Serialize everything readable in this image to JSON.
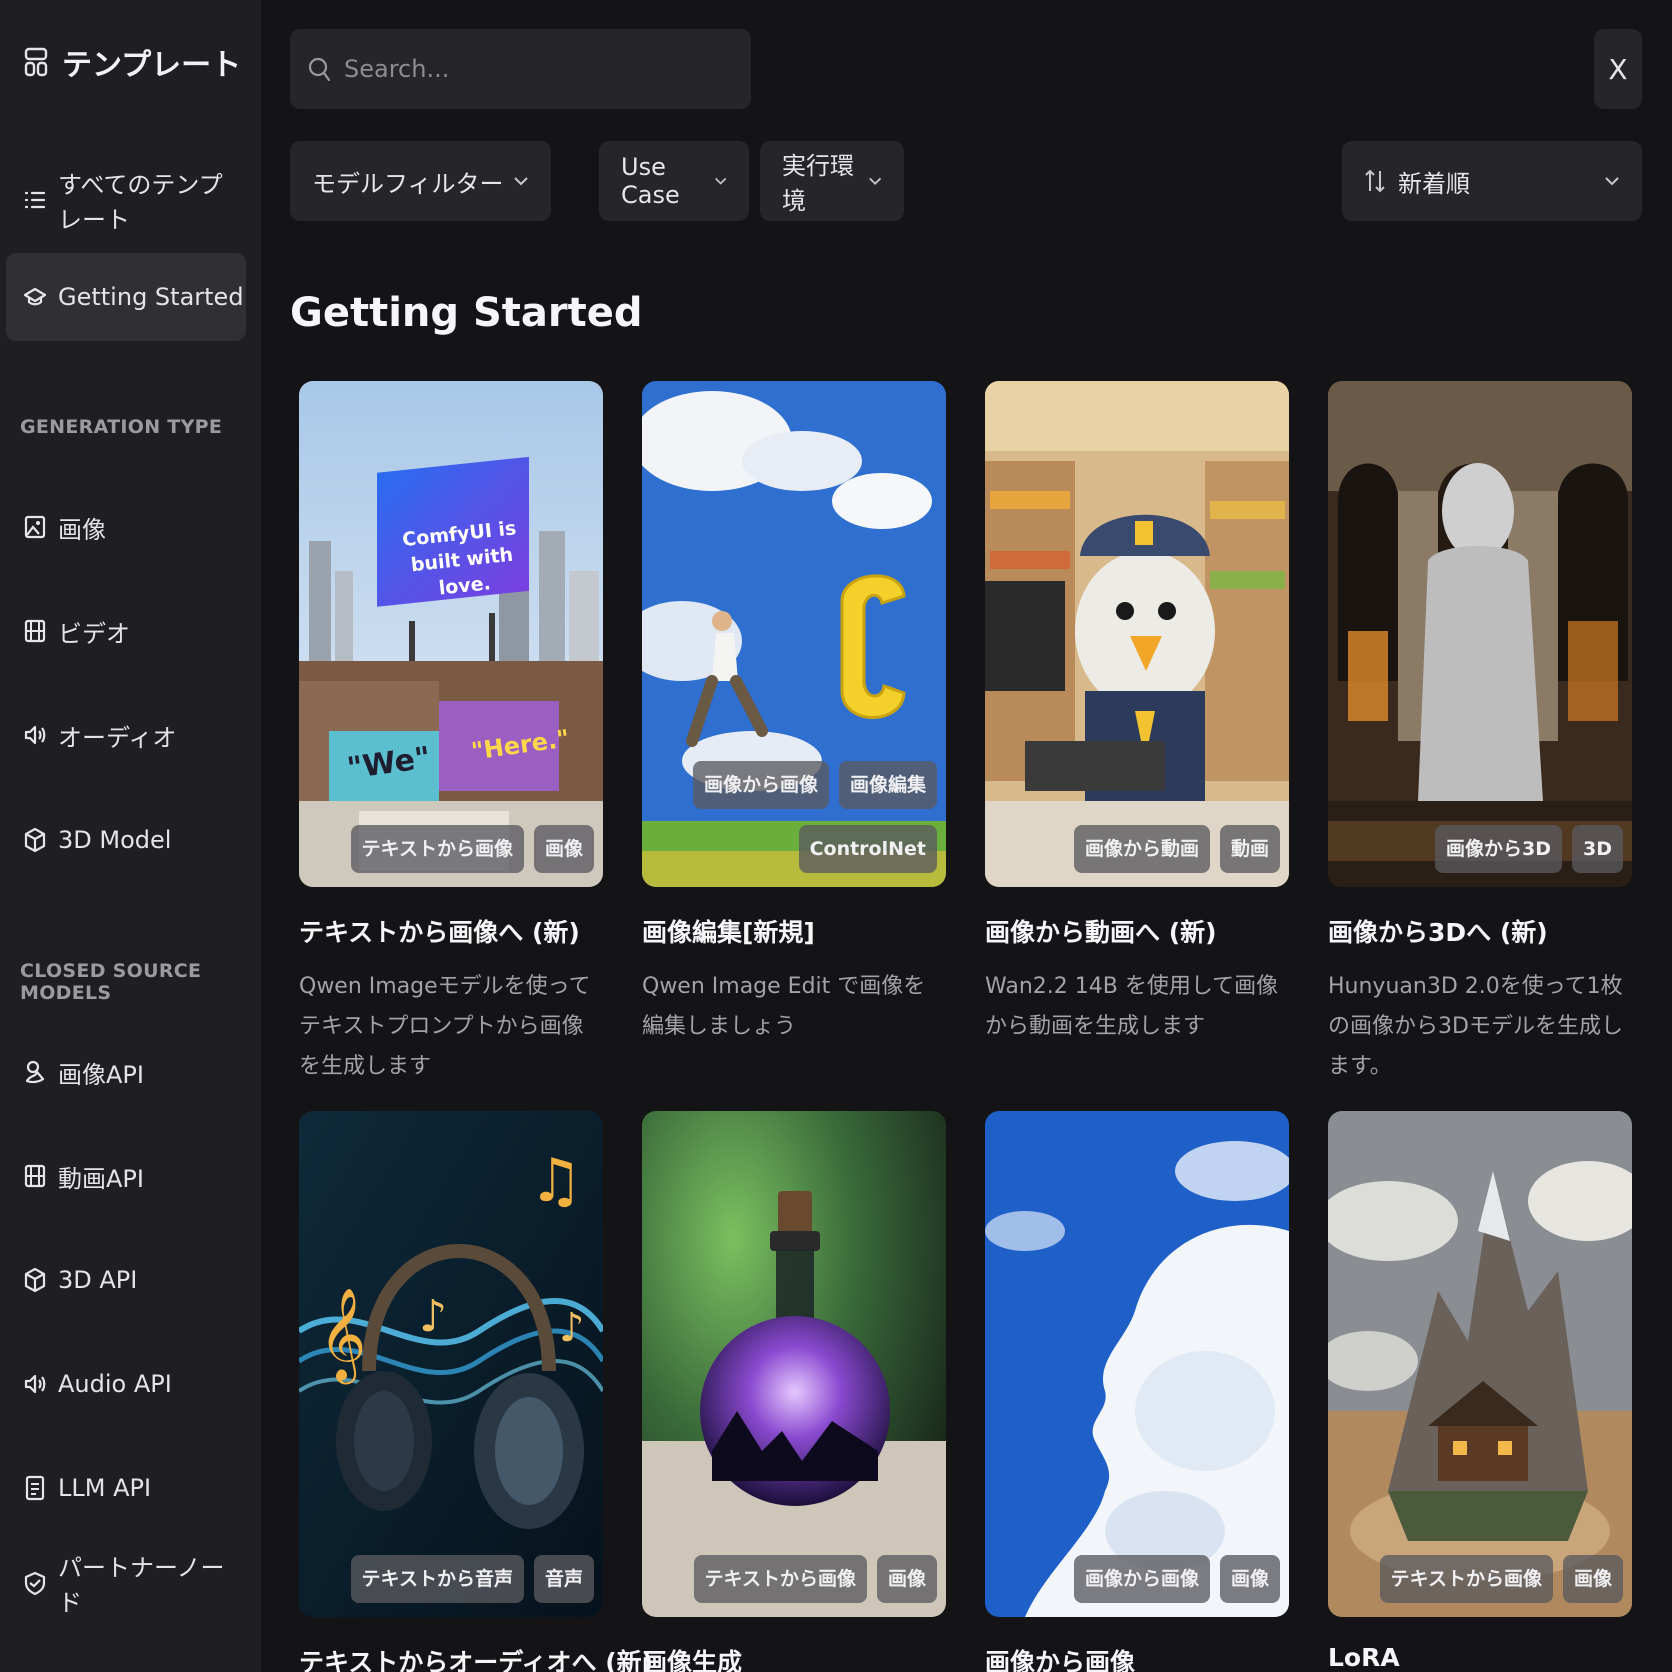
{
  "sidebar": {
    "title": "テンプレート",
    "all_templates": "すべてのテンプレート",
    "getting_started": "Getting Started",
    "generation_type_label": "GENERATION TYPE",
    "generation_types": [
      "画像",
      "ビデオ",
      "オーディオ",
      "3D Model"
    ],
    "closed_source_label": "CLOSED SOURCE MODELS",
    "closed_source": [
      "画像API",
      "動画API",
      "3D API",
      "Audio API",
      "LLM API",
      "パートナーノード"
    ]
  },
  "search": {
    "placeholder": "Search..."
  },
  "close_label": "X",
  "filters": {
    "model": "モデルフィルター",
    "use_case": "Use Case",
    "runtime": "実行環境",
    "sort": "新着順"
  },
  "page_title": "Getting Started",
  "cards": [
    {
      "title": "テキストから画像へ (新)",
      "desc": "Qwen Imageモデルを使ってテキストプロンプトから画像を生成します",
      "tags": [
        [
          "テキストから画像",
          "画像"
        ]
      ]
    },
    {
      "title": "画像編集[新規]",
      "desc": "Qwen Image Edit で画像を編集しましょう",
      "tags": [
        [
          "画像から画像",
          "画像編集"
        ],
        [
          "ControlNet"
        ]
      ]
    },
    {
      "title": "画像から動画へ (新)",
      "desc": "Wan2.2 14B を使用して画像から動画を生成します",
      "tags": [
        [
          "画像から動画",
          "動画"
        ]
      ]
    },
    {
      "title": "画像から3Dへ (新)",
      "desc": "Hunyuan3D 2.0を使って1枚の画像から3Dモデルを生成します。",
      "tags": [
        [
          "画像から3D",
          "3D"
        ]
      ]
    },
    {
      "title": "テキストからオーディオへ (新)",
      "desc": "",
      "tags": [
        [
          "テキストから音声",
          "音声"
        ]
      ]
    },
    {
      "title": "画像生成",
      "desc": "",
      "tags": [
        [
          "テキストから画像",
          "画像"
        ]
      ]
    },
    {
      "title": "画像から画像",
      "desc": "",
      "tags": [
        [
          "画像から画像",
          "画像"
        ]
      ]
    },
    {
      "title": "LoRA",
      "desc": "",
      "tags": [
        [
          "テキストから画像",
          "画像"
        ]
      ]
    }
  ],
  "thumb_text": {
    "billboard": "ComfyUI is built with love.",
    "graffiti_1": "\"We\"",
    "graffiti_2": "\"Here.\""
  }
}
